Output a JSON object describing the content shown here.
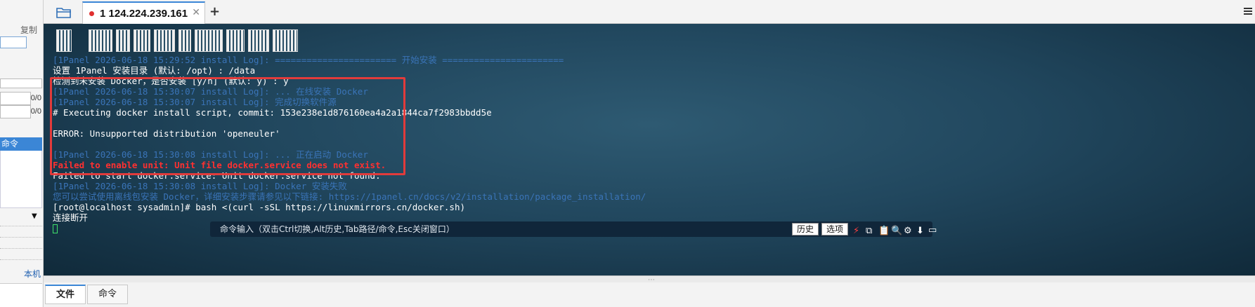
{
  "left_panel": {
    "copy_label": "复制",
    "count_1": "0/0",
    "count_2": "0/0",
    "selected_item": "命令",
    "local_label": "本机"
  },
  "tabs": [
    {
      "label": "1 124.224.239.161",
      "active": true,
      "status_color": "#e03030"
    }
  ],
  "terminal": {
    "lines": [
      {
        "text": "[1Panel 2026-06-18 15:29:52 install Log]: ======================= 开始安装 =======================",
        "style": "dim"
      },
      {
        "text": "设置 1Panel 安装目录 (默认: /opt) : /data",
        "style": "white"
      },
      {
        "text": "检测到未安装 Docker，是否安装 [y/n] (默认: y) : y",
        "style": "white"
      },
      {
        "text": "[1Panel 2026-06-18 15:30:07 install Log]: ... 在线安装 Docker",
        "style": "dim"
      },
      {
        "text": "[1Panel 2026-06-18 15:30:07 install Log]: 完成切换软件源",
        "style": "dim"
      },
      {
        "text": "# Executing docker install script, commit: 153e238e1d876160ea4a2a1844ca7f2983bbdd5e",
        "style": "white"
      },
      {
        "text": "",
        "style": "white"
      },
      {
        "text": "ERROR: Unsupported distribution 'openeuler'",
        "style": "white"
      },
      {
        "text": "",
        "style": "white"
      },
      {
        "text": "[1Panel 2026-06-18 15:30:08 install Log]: ... 正在启动 Docker",
        "style": "dim"
      },
      {
        "text": "Failed to enable unit: Unit file docker.service does not exist.",
        "style": "red"
      },
      {
        "text": "Failed to start docker.service: Unit docker.service not found.",
        "style": "white"
      },
      {
        "text": "[1Panel 2026-06-18 15:30:08 install Log]: Docker 安装失败",
        "style": "dim"
      },
      {
        "text": "您可以尝试使用离线包安装 Docker，详细安装步骤请参见以下链接: https://1panel.cn/docs/v2/installation/package_installation/",
        "style": "dim"
      },
      {
        "text": "[root@localhost sysadmin]# bash <(curl -sSL https://linuxmirrors.cn/docker.sh)",
        "style": "white"
      },
      {
        "text": "连接断开",
        "style": "white"
      }
    ],
    "cursor_color": "#3fe06a"
  },
  "command_bar": {
    "hint": "命令输入（双击Ctrl切换,Alt历史,Tab路径/命令,Esc关闭窗口）",
    "history_label": "历史",
    "options_label": "选项"
  },
  "bottom_tabs": [
    {
      "label": "文件",
      "active": true
    },
    {
      "label": "命令",
      "active": false
    }
  ],
  "colors": {
    "accent": "#3b86d6",
    "error_red": "#ff3030",
    "highlight_box": "#e23b3b"
  }
}
